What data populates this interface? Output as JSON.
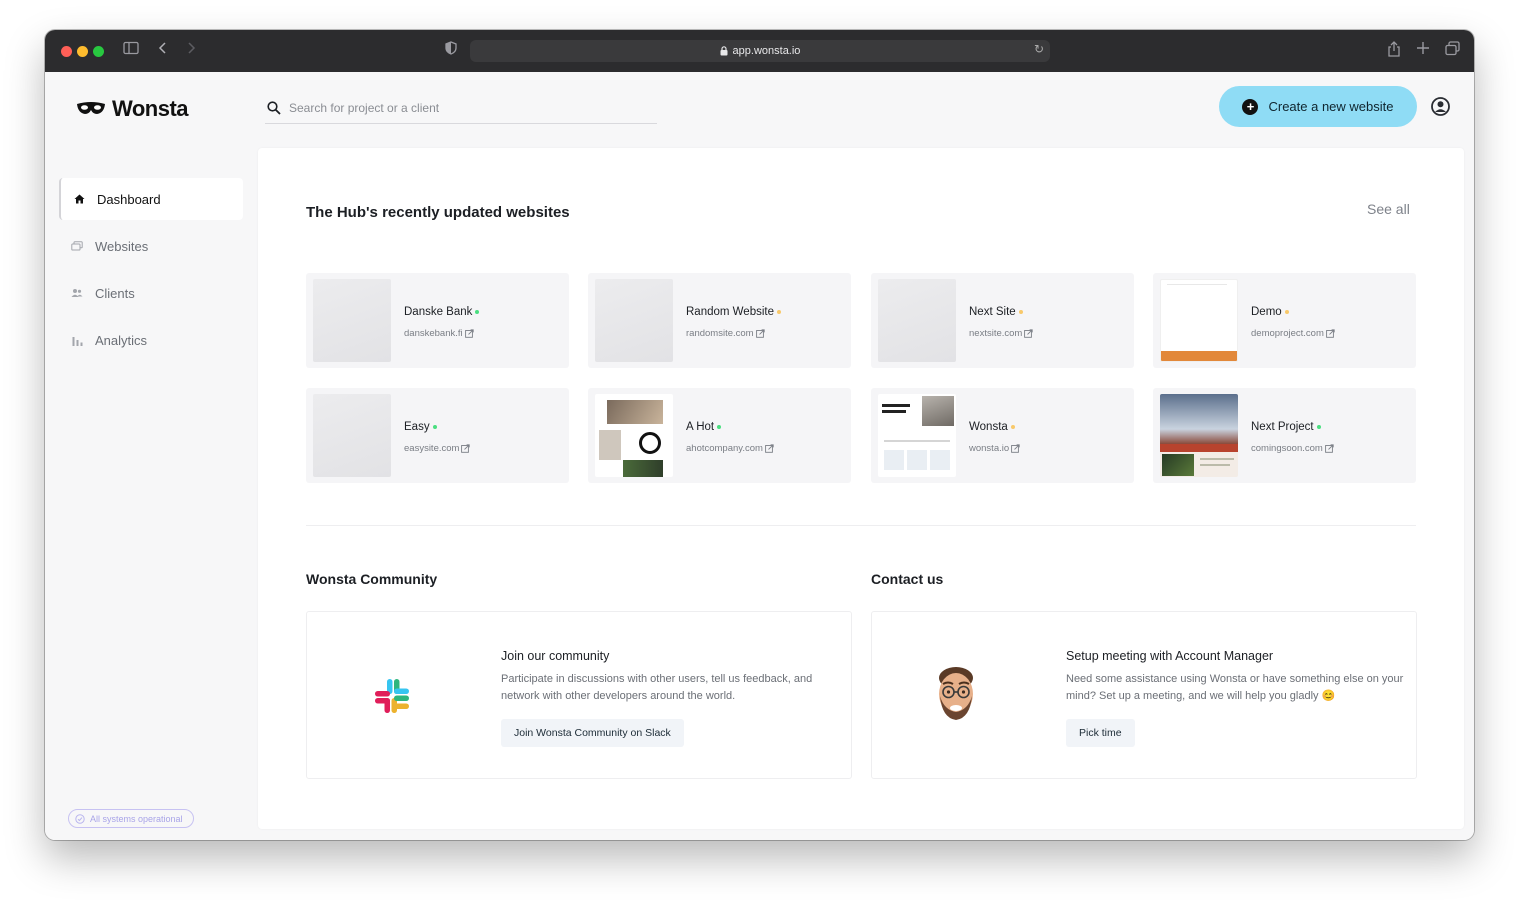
{
  "browser": {
    "url": "app.wonsta.io"
  },
  "app": {
    "logo_text": "Wonsta"
  },
  "search": {
    "placeholder": "Search for project or a client"
  },
  "header": {
    "create_label": "Create a new website"
  },
  "sidebar": {
    "items": [
      {
        "label": "Dashboard",
        "icon": "home-icon",
        "active": true
      },
      {
        "label": "Websites",
        "icon": "websites-icon",
        "active": false
      },
      {
        "label": "Clients",
        "icon": "clients-icon",
        "active": false
      },
      {
        "label": "Analytics",
        "icon": "analytics-icon",
        "active": false
      }
    ],
    "status": "All systems operational"
  },
  "recent": {
    "title": "The Hub's recently updated websites",
    "see_all": "See all",
    "sites": [
      {
        "name": "Danske Bank",
        "url": "danskebank.fi",
        "status_color": "#4ade80"
      },
      {
        "name": "Random Website",
        "url": "randomsite.com",
        "status_color": "#f8c96b"
      },
      {
        "name": "Next Site",
        "url": "nextsite.com",
        "status_color": "#f8c96b"
      },
      {
        "name": "Demo",
        "url": "demoproject.com",
        "status_color": "#f8c96b"
      },
      {
        "name": "Easy",
        "url": "easysite.com",
        "status_color": "#4ade80"
      },
      {
        "name": "A Hot",
        "url": "ahotcompany.com",
        "status_color": "#4ade80"
      },
      {
        "name": "Wonsta",
        "url": "wonsta.io",
        "status_color": "#f8c96b"
      },
      {
        "name": "Next Project",
        "url": "comingsoon.com",
        "status_color": "#4ade80"
      }
    ]
  },
  "community": {
    "section_title": "Wonsta Community",
    "title": "Join our community",
    "text": "Participate in discussions with other users, tell us feedback, and network with other developers around the world.",
    "button": "Join Wonsta Community on Slack",
    "icon": "slack-icon"
  },
  "contact": {
    "section_title": "Contact us",
    "title": "Setup meeting with Account Manager",
    "text": "Need some assistance using Wonsta or have something else on your mind? Set up a meeting, and we will help you gladly 😊",
    "button": "Pick time",
    "icon": "account-manager-avatar"
  },
  "colors": {
    "accent": "#8fdcf5",
    "status_green": "#4ade80",
    "status_yellow": "#f8c96b",
    "status_pill": "#a9a4e8"
  }
}
